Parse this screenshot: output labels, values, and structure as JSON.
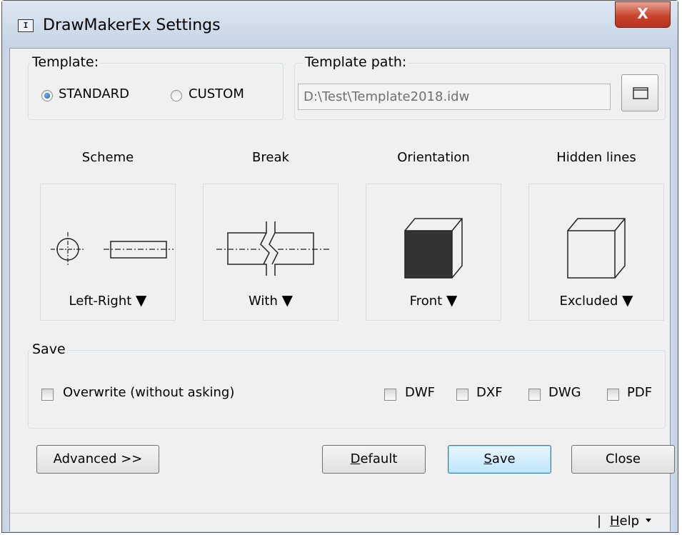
{
  "window": {
    "title": "DrawMakerEx Settings",
    "icon_glyph": "I",
    "close_glyph": "X"
  },
  "template": {
    "group_label": "Template:",
    "options": [
      {
        "label": "STANDARD",
        "checked": true
      },
      {
        "label": "CUSTOM",
        "checked": false
      }
    ]
  },
  "template_path": {
    "group_label": "Template path:",
    "value": "D:\\Test\\Template2018.idw",
    "browse_icon": "folder-icon"
  },
  "options": [
    {
      "heading": "Scheme",
      "value": "Left-Right",
      "caret": "▼"
    },
    {
      "heading": "Break",
      "value": "With",
      "caret": "▼"
    },
    {
      "heading": "Orientation",
      "value": "Front",
      "caret": "▼"
    },
    {
      "heading": "Hidden lines",
      "value": "Excluded",
      "caret": "▼"
    }
  ],
  "save": {
    "group_label": "Save",
    "overwrite_label": "Overwrite (without asking)",
    "formats": [
      "DWF",
      "DXF",
      "DWG",
      "PDF"
    ]
  },
  "buttons": {
    "advanced": "Advanced >>",
    "default_mnemonic": "D",
    "default_rest": "efault",
    "save_mnemonic": "S",
    "save_rest": "ave",
    "close": "Close"
  },
  "status": {
    "separator": "|",
    "help_mnemonic": "H",
    "help_rest": "elp"
  },
  "colors": {
    "title_gradient_top": "#dde7f2",
    "close_button": "#c8442c",
    "dialog_bg": "#f0f0f0",
    "focus_border": "#3c7fb1"
  }
}
